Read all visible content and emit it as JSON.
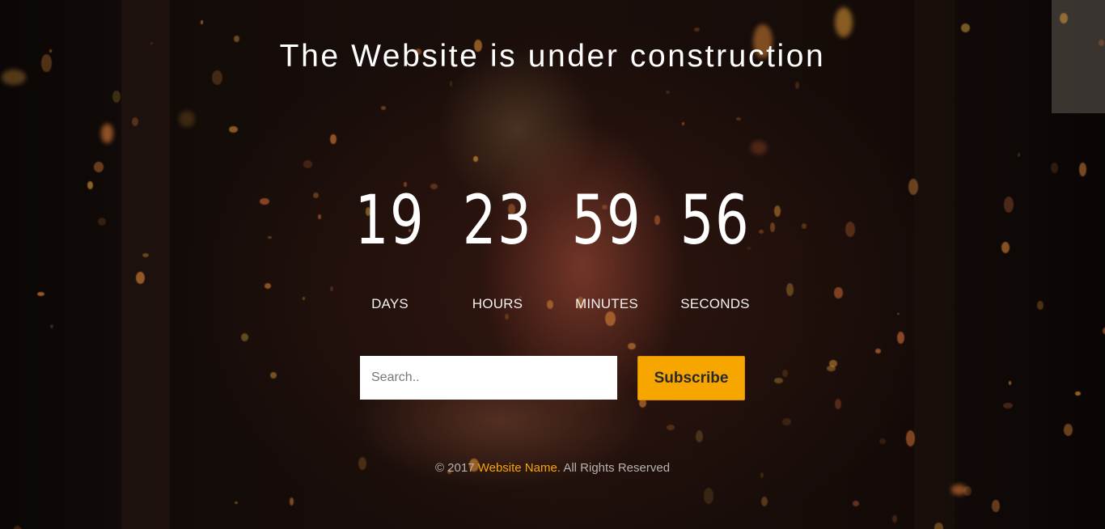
{
  "page": {
    "title": "The Website is under construction"
  },
  "countdown": [
    {
      "value": "19",
      "label": "DAYS"
    },
    {
      "value": "23",
      "label": "HOURS"
    },
    {
      "value": "59",
      "label": "MINUTES"
    },
    {
      "value": "56",
      "label": "SECONDS"
    }
  ],
  "subscribe": {
    "placeholder": "Search..",
    "button_label": "Subscribe"
  },
  "footer": {
    "prefix": "© 2017",
    "link_text": "Website Name.",
    "suffix": "All Rights Reserved"
  },
  "colors": {
    "accent": "#f7a600",
    "text": "#ffffff",
    "footer_text": "#b8b2ae"
  }
}
